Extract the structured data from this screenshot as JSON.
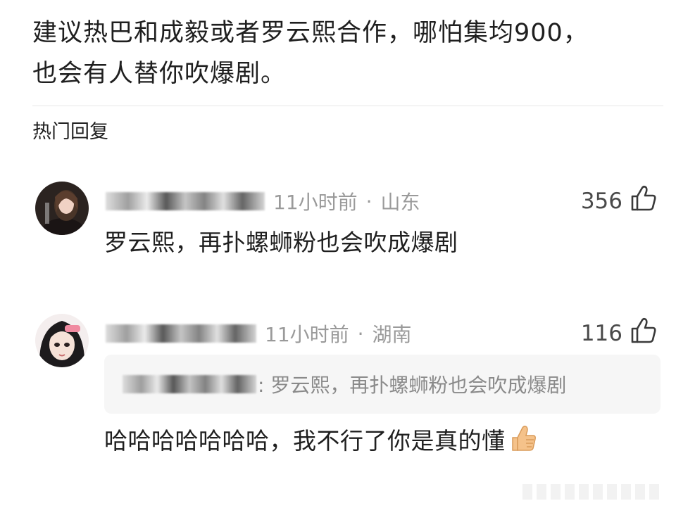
{
  "post": {
    "line1": "建议热巴和成毅或者罗云熙合作，哪怕集均900，",
    "line2": "也会有人替你吹爆剧。"
  },
  "section": {
    "title": "热门回复"
  },
  "comments": [
    {
      "time": "11小时前",
      "separator": "·",
      "location": "山东",
      "likes": "356",
      "text": "罗云熙，再扑螺蛳粉也会吹成爆剧"
    },
    {
      "time": "11小时前",
      "separator": "·",
      "location": "湖南",
      "likes": "116",
      "quote": ": 罗云熙，再扑螺蛳粉也会吹成爆剧",
      "text": "哈哈哈哈哈哈哈，我不行了你是真的懂"
    }
  ],
  "icons": {
    "like": "thumbs-up-outline-icon",
    "emoji": "thumbs-up-emoji-icon"
  },
  "colors": {
    "meta_text": "#9a9a9a",
    "body_text": "#1f1f1f",
    "quote_bg": "#f6f6f6",
    "emoji_skin": "#f5c28a"
  }
}
